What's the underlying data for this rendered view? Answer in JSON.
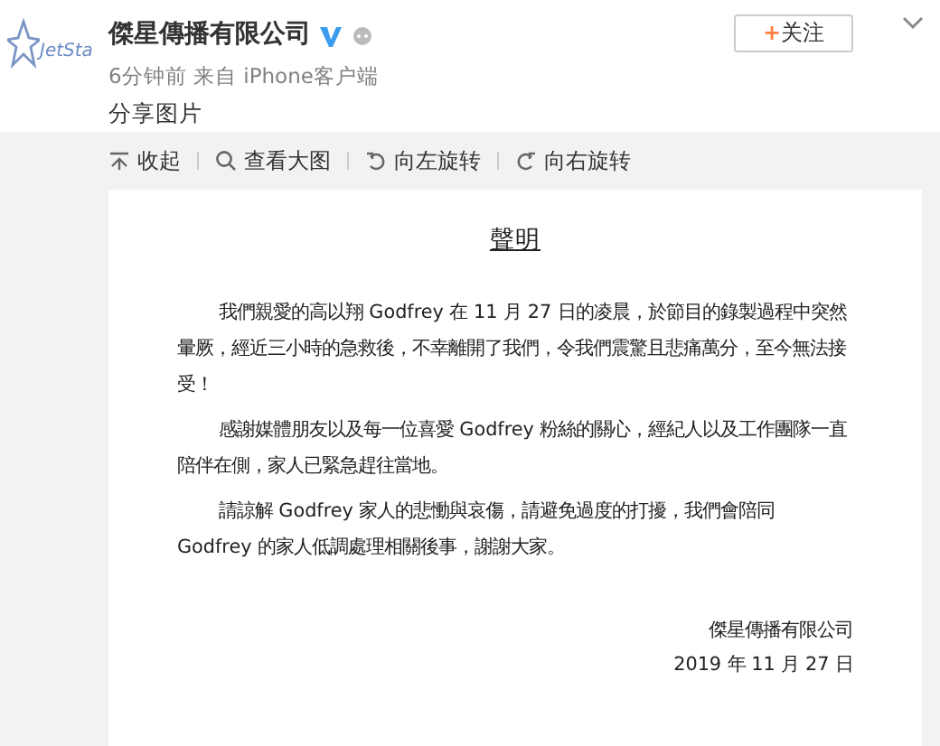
{
  "post": {
    "logo_text": "JetSta",
    "author": "傑星傳播有限公司",
    "verified": true,
    "meta": "6分钟前 来自 iPhone客户端",
    "text": "分享图片",
    "follow_button": {
      "plus": "+",
      "label": "关注"
    }
  },
  "toolbar": [
    {
      "kind": "collapse",
      "label": "收起"
    },
    {
      "kind": "zoom",
      "label": "查看大图"
    },
    {
      "kind": "rotate_left",
      "label": "向左旋转"
    },
    {
      "kind": "rotate_right",
      "label": "向右旋转"
    }
  ],
  "document": {
    "title": "聲明",
    "paragraphs": [
      "我們親愛的高以翔 Godfrey 在 11 月 27 日的凌晨，於節目的錄製過程中突然暈厥，經近三小時的急救後，不幸離開了我們，令我們震驚且悲痛萬分，至今無法接受！",
      "感謝媒體朋友以及每一位喜愛 Godfrey 粉絲的關心，經紀人以及工作團隊一直陪伴在側，家人已緊急趕往當地。",
      "請諒解 Godfrey 家人的悲慟與哀傷，請避免過度的打擾，我們會陪同 Godfrey 的家人低調處理相關後事，謝謝大家。"
    ],
    "signature": "傑星傳播有限公司",
    "date": "2019 年 11 月 27 日"
  }
}
